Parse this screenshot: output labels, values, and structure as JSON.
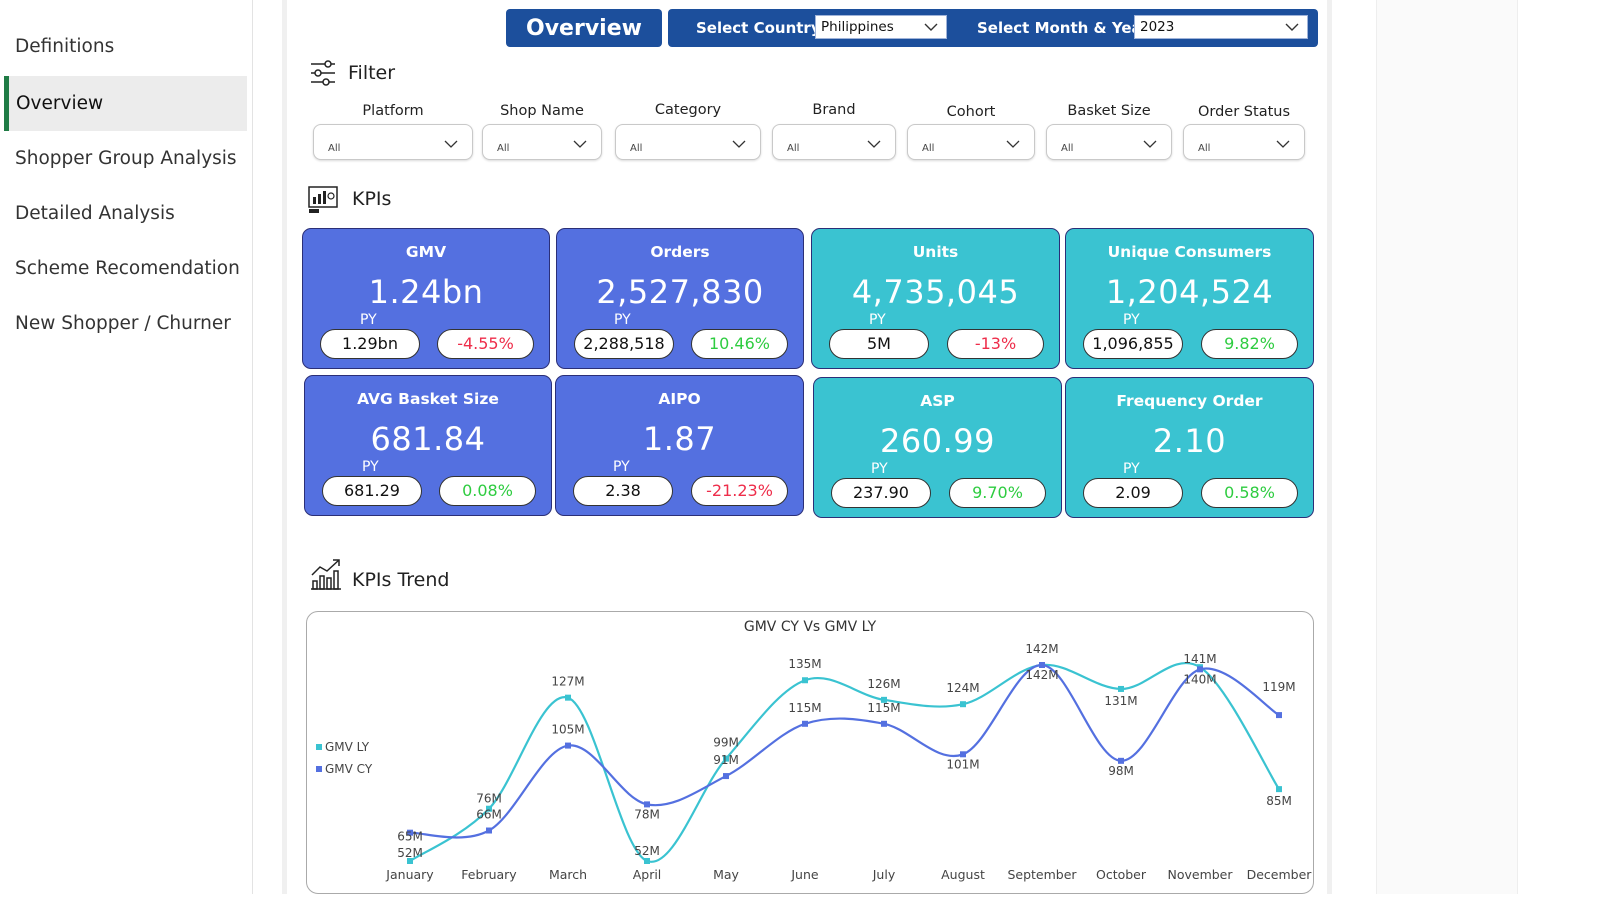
{
  "sidebar": {
    "items": [
      {
        "label": "Definitions",
        "active": false
      },
      {
        "label": "Overview",
        "active": true
      },
      {
        "label": "Shopper Group Analysis",
        "active": false
      },
      {
        "label": "Detailed Analysis",
        "active": false
      },
      {
        "label": "Scheme Recomendation",
        "active": false
      },
      {
        "label": "New Shopper / Churner",
        "active": false
      }
    ]
  },
  "header": {
    "overview_label": "Overview",
    "country_label": "Select Country",
    "country_value": "Philippines",
    "month_year_label": "Select Month & Year",
    "month_year_value": "2023"
  },
  "filter": {
    "title": "Filter",
    "fields": [
      {
        "label": "Platform",
        "value": "All"
      },
      {
        "label": "Shop Name",
        "value": "All"
      },
      {
        "label": "Category",
        "value": "All"
      },
      {
        "label": "Brand",
        "value": "All"
      },
      {
        "label": "Cohort",
        "value": "All"
      },
      {
        "label": "Basket Size",
        "value": "All"
      },
      {
        "label": "Order Status",
        "value": "All"
      }
    ]
  },
  "kpis": {
    "title": "KPIs",
    "py_label": "PY",
    "cards": [
      {
        "title": "GMV",
        "value": "1.24bn",
        "py": "1.29bn",
        "change": "-4.55%",
        "trend": "neg",
        "color": "#5470e0"
      },
      {
        "title": "Orders",
        "value": "2,527,830",
        "py": "2,288,518",
        "change": "10.46%",
        "trend": "pos",
        "color": "#5470e0"
      },
      {
        "title": "Units",
        "value": "4,735,045",
        "py": "5M",
        "change": "-13%",
        "trend": "neg",
        "color": "#3ac3d1"
      },
      {
        "title": "Unique Consumers",
        "value": "1,204,524",
        "py": "1,096,855",
        "change": "9.82%",
        "trend": "pos",
        "color": "#3ac3d1"
      },
      {
        "title": "AVG Basket Size",
        "value": "681.84",
        "py": "681.29",
        "change": "0.08%",
        "trend": "pos",
        "color": "#5470e0"
      },
      {
        "title": "AIPO",
        "value": "1.87",
        "py": "2.38",
        "change": "-21.23%",
        "trend": "neg",
        "color": "#5470e0"
      },
      {
        "title": "ASP",
        "value": "260.99",
        "py": "237.90",
        "change": "9.70%",
        "trend": "pos",
        "color": "#3ac3d1"
      },
      {
        "title": "Frequency Order",
        "value": "2.10",
        "py": "2.09",
        "change": "0.58%",
        "trend": "pos",
        "color": "#3ac3d1"
      }
    ]
  },
  "trend": {
    "title": "KPIs Trend"
  },
  "chart_data": {
    "type": "line",
    "title": "GMV CY Vs GMV LY",
    "categories": [
      "January",
      "February",
      "March",
      "April",
      "May",
      "June",
      "July",
      "August",
      "September",
      "October",
      "November",
      "December"
    ],
    "series": [
      {
        "name": "GMV LY",
        "color": "#3ac3d1",
        "values": [
          52,
          76,
          127,
          52,
          99,
          135,
          126,
          124,
          142,
          131,
          141,
          85
        ],
        "labels": [
          "52M",
          "76M",
          "127M",
          "52M",
          "99M",
          "135M",
          "126M",
          "124M",
          "142M",
          "131M",
          "141M",
          "85M"
        ]
      },
      {
        "name": "GMV CY",
        "color": "#5470e0",
        "values": [
          65,
          66,
          105,
          78,
          91,
          115,
          115,
          101,
          142,
          98,
          140,
          119
        ],
        "labels": [
          "65M",
          "66M",
          "105M",
          "78M",
          "91M",
          "115M",
          "115M",
          "101M",
          "142M",
          "98M",
          "140M",
          "119M"
        ]
      }
    ],
    "legend_position": "left"
  }
}
